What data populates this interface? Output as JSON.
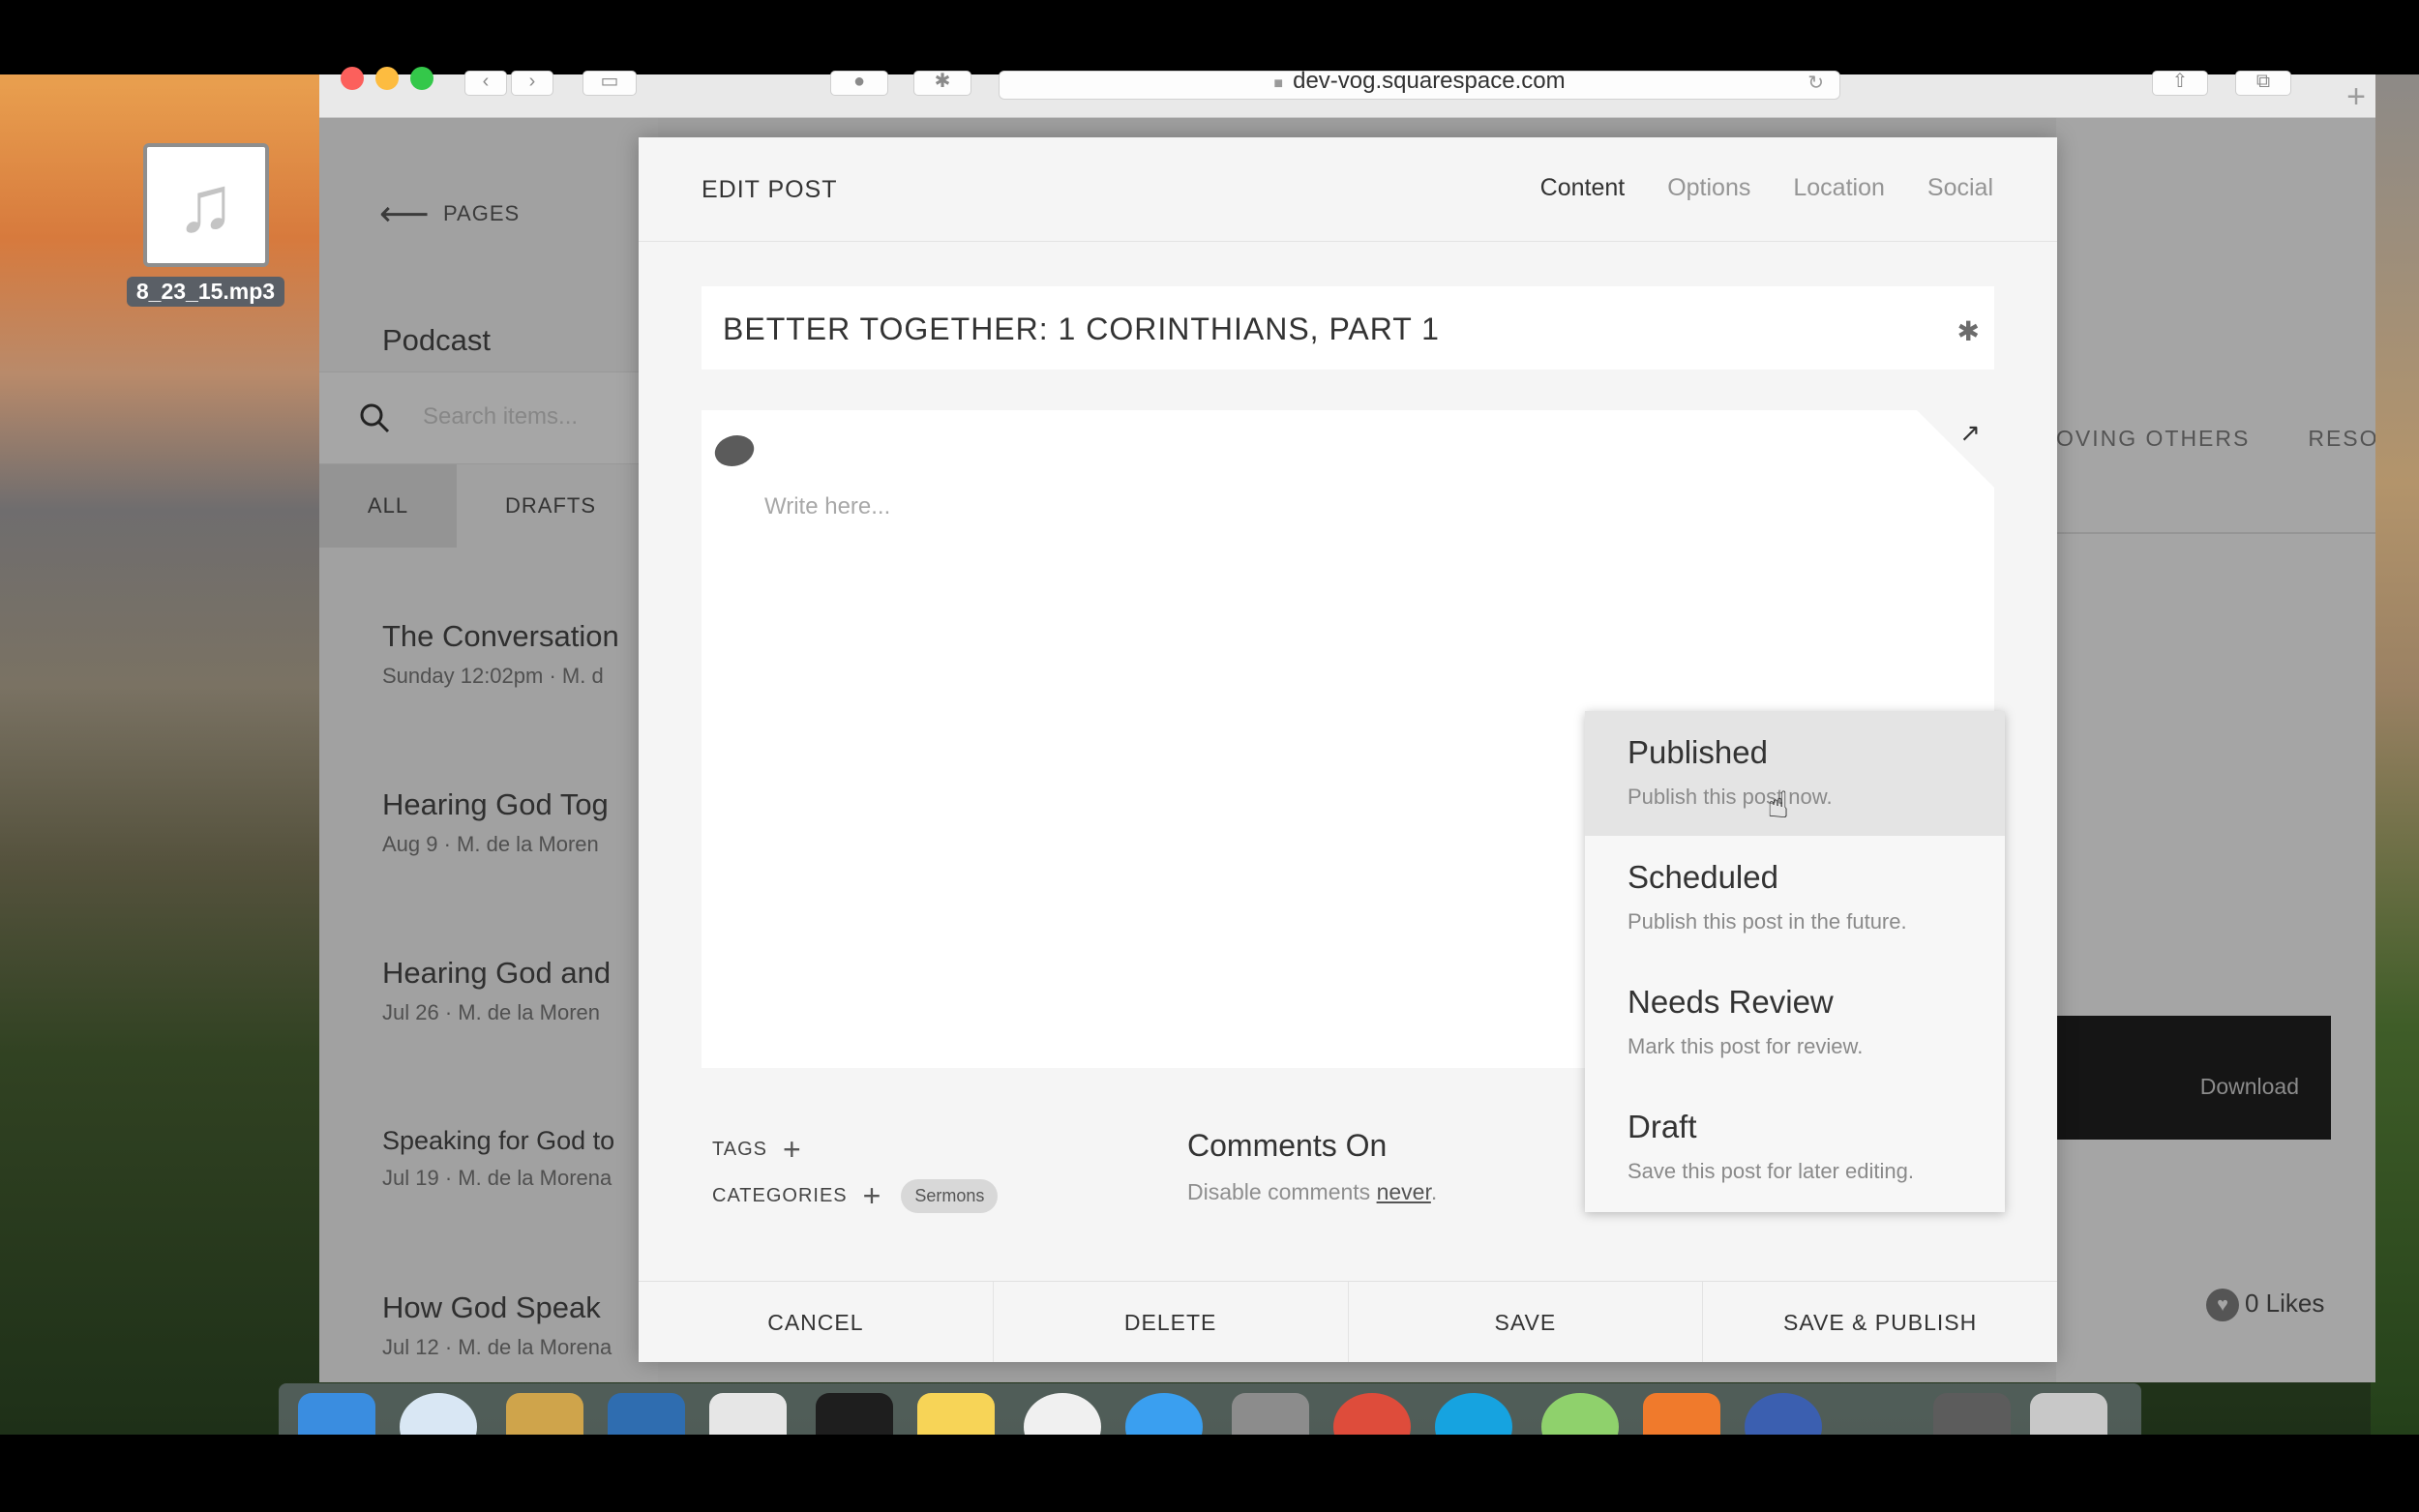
{
  "desktop": {
    "file_name": "8_23_15.mp3"
  },
  "browser": {
    "url": "dev-vog.squarespace.com"
  },
  "sidebar": {
    "back_label": "PAGES",
    "page_title": "Podcast",
    "search_placeholder": "Search items...",
    "filters": [
      "ALL",
      "DRAFTS"
    ],
    "items": [
      {
        "title": "The Conversation",
        "meta": "Sunday 12:02pm · M. d"
      },
      {
        "title": "Hearing God Tog",
        "meta": "Aug 9 · M. de la Moren"
      },
      {
        "title": "Hearing God and",
        "meta": "Jul 26 · M. de la Moren"
      },
      {
        "title": "Speaking for God to",
        "meta": "Jul 19 · M. de la Morena"
      },
      {
        "title": "How God Speak",
        "meta": "Jul 12 · M. de la Morena"
      }
    ]
  },
  "page_bg": {
    "nav": [
      "OVING OTHERS",
      "RESOU"
    ],
    "download_label": "Download",
    "likes_label": "0 Likes"
  },
  "dialog": {
    "title": "EDIT POST",
    "tabs": [
      "Content",
      "Options",
      "Location",
      "Social"
    ],
    "active_tab": "Content",
    "post_title": "BETTER TOGETHER: 1 CORINTHIANS, PART 1",
    "body_placeholder": "Write here...",
    "tags_label": "TAGS",
    "categories_label": "CATEGORIES",
    "category_chip": "Sermons",
    "comments_heading": "Comments On",
    "comments_sub_prefix": "Disable comments",
    "comments_sub_link": "never",
    "footer": {
      "cancel": "CANCEL",
      "delete": "DELETE",
      "save": "SAVE",
      "save_publish": "SAVE & PUBLISH"
    }
  },
  "status_menu": {
    "hovered": "Published",
    "options": [
      {
        "label": "Published",
        "desc": "Publish this post now."
      },
      {
        "label": "Scheduled",
        "desc": "Publish this post in the future."
      },
      {
        "label": "Needs Review",
        "desc": "Mark this post for review."
      },
      {
        "label": "Draft",
        "desc": "Save this post for later editing."
      }
    ]
  }
}
